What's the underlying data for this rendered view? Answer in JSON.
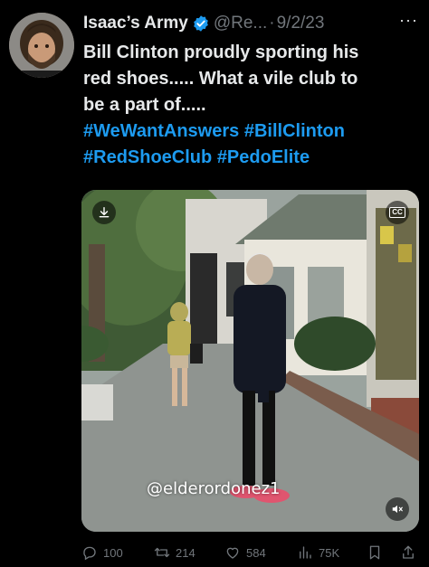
{
  "tweet": {
    "author_name": "Isaac’s Army",
    "handle": "@Re...",
    "separator": "·",
    "date": "9/2/23",
    "more_label": "···",
    "text_lines": [
      "Bill Clinton proudly sporting his",
      "red shoes..... What a vile club to",
      "be  a part of....."
    ],
    "hashtag_lines": [
      [
        "#WeWantAnswers",
        "#BillClinton"
      ],
      [
        "#RedShoeClub",
        "#PedoElite"
      ]
    ]
  },
  "media": {
    "watermark": "@elderordonez1",
    "download_icon": "download-icon",
    "captions_label": "CC",
    "mute_icon": "muted-speaker-icon"
  },
  "actions": {
    "replies": "100",
    "retweets": "214",
    "likes": "584",
    "views": "75K"
  },
  "colors": {
    "background": "#000000",
    "text": "#e7e9ea",
    "muted": "#71767b",
    "link": "#1d9bf0",
    "verified": "#1d9bf0"
  }
}
